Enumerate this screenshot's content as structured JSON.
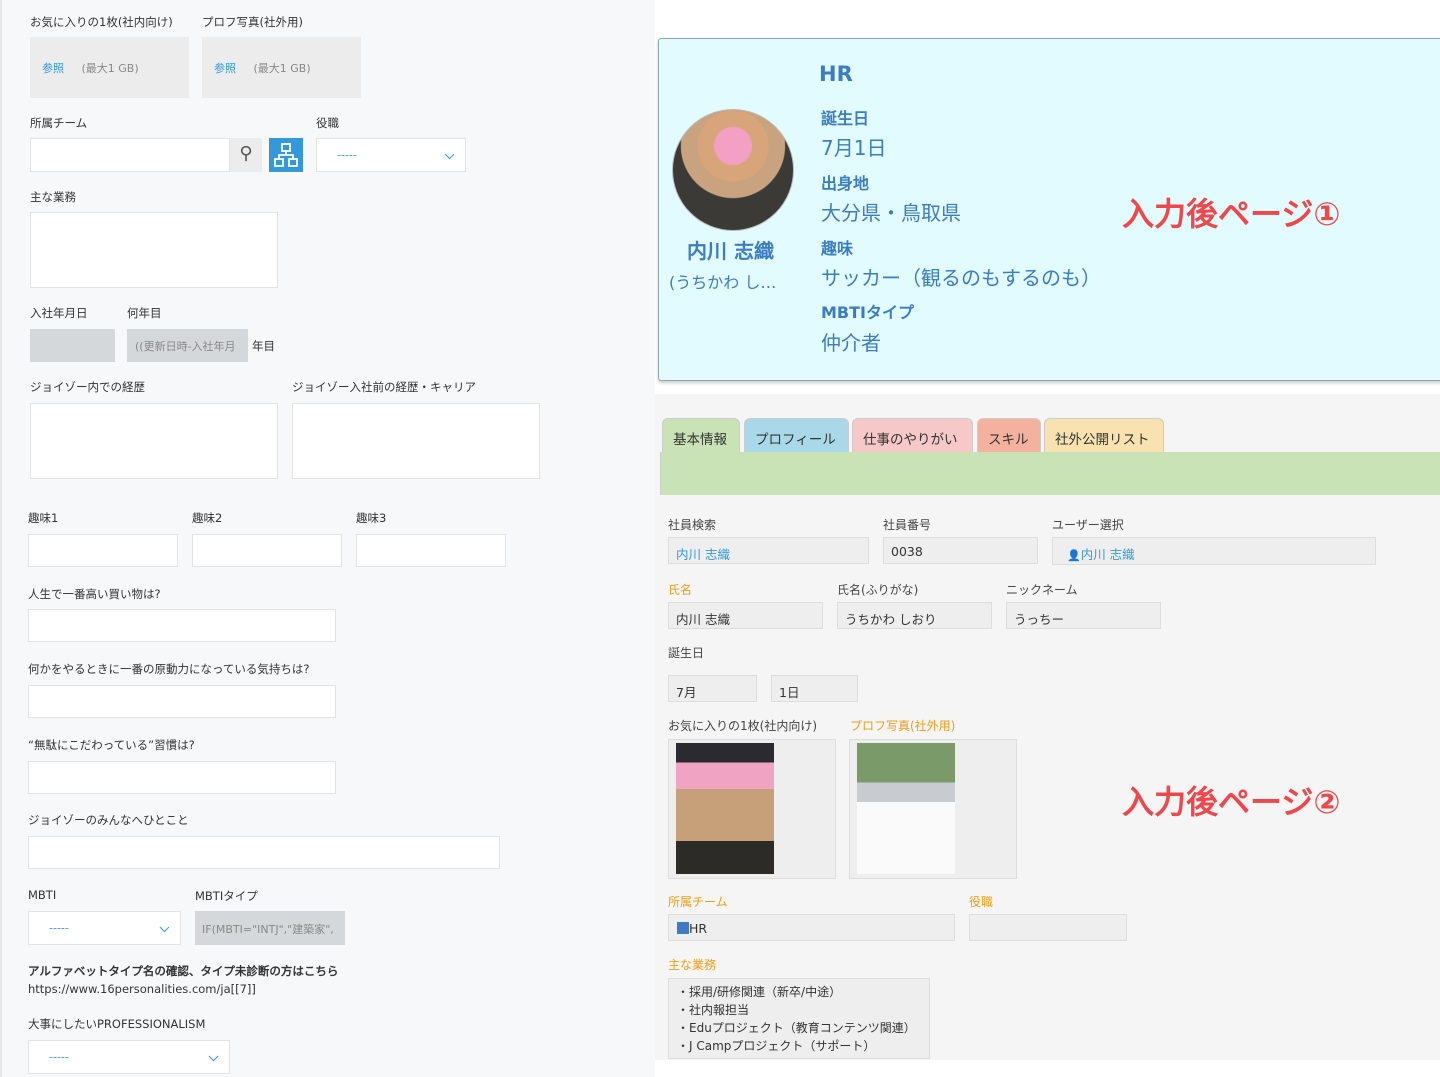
{
  "form": {
    "fav_photo_label": "お気に入りの1枚(社内向け)",
    "prof_photo_label": "プロフ写真(社外用)",
    "browse": "参照",
    "max_size": "(最大1 GB)",
    "team_label": "所属チーム",
    "role_label": "役職",
    "select_empty": "-----",
    "duties_label": "主な業務",
    "join_date_label": "入社年月日",
    "years_label": "何年目",
    "years_formula": "((更新日時-入社年月",
    "years_suffix": "年目",
    "career_in_label": "ジョイゾー内での経歴",
    "career_before_label": "ジョイゾー入社前の経歴・キャリア",
    "hobby1": "趣味1",
    "hobby2": "趣味2",
    "hobby3": "趣味3",
    "q_purchase": "人生で一番高い買い物は?",
    "q_motivation": "何かをやるときに一番の原動力になっている気持ちは?",
    "q_habit": "“無駄にこだわっている”習慣は?",
    "q_message": "ジョイゾーのみんなへひとこと",
    "mbti_label": "MBTI",
    "mbti_type_label": "MBTIタイプ",
    "mbti_formula": "IF(MBTI=\"INTJ\",\"建築家\",",
    "mbti_note": "アルファベットタイプ名の確認、タイプ未診断の方はこちら",
    "mbti_url": "https://www.16personalities.com/ja[[7]]",
    "professionalism_label": "大事にしたいPROFESSIONALISM"
  },
  "card": {
    "team": "HR",
    "name": "内川 志織",
    "kana": "(うちかわ し…",
    "birthday_label": "誕生日",
    "birthday": "7月1日",
    "hometown_label": "出身地",
    "hometown": "大分県・鳥取県",
    "hobby_label": "趣味",
    "hobby": "サッカー（観るのもするのも）",
    "mbti_label": "MBTIタイプ",
    "mbti": "仲介者",
    "annotation": "入力後ページ①"
  },
  "tabs": [
    "基本情報",
    "プロフィール",
    "仕事のやりがい",
    "スキル",
    "社外公開リスト"
  ],
  "detail": {
    "emp_search_label": "社員検索",
    "emp_search": "内川 志織",
    "emp_no_label": "社員番号",
    "emp_no": "0038",
    "user_label": "ユーザー選択",
    "user": "内川 志織",
    "name_label": "氏名",
    "name": "内川 志織",
    "kana_label": "氏名(ふりがな)",
    "kana": "うちかわ しおり",
    "nick_label": "ニックネーム",
    "nick": "うっちー",
    "birthday_label": "誕生日",
    "month": "7月",
    "day": "1日",
    "fav_photo_label": "お気に入りの1枚(社内向け)",
    "prof_photo_label": "プロフ写真(社外用)",
    "team_label": "所属チーム",
    "team": "HR",
    "role_label": "役職",
    "duties_label": "主な業務",
    "duties": [
      "・採用/研修関連（新卒/中途）",
      "・社内報担当",
      "・Eduプロジェクト（教育コンテンツ関連）",
      "・J Campプロジェクト（サポート）"
    ],
    "annotation": "入力後ページ②"
  }
}
